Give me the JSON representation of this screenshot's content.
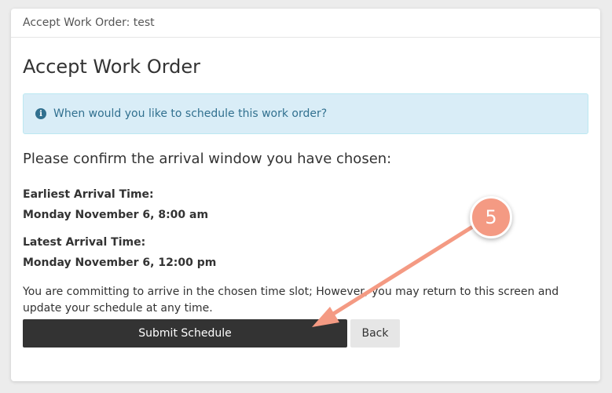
{
  "window": {
    "title": "Accept Work Order: test"
  },
  "page": {
    "title": "Accept Work Order"
  },
  "alert": {
    "icon": "info-icon",
    "text": "When would you like to schedule this work order?",
    "color": "#31708f",
    "background": "#d9edf7"
  },
  "confirm": {
    "heading": "Please confirm the arrival window you have chosen:",
    "earliest_label": "Earliest Arrival Time:",
    "earliest_value": "Monday November 6, 8:00 am",
    "latest_label": "Latest Arrival Time:",
    "latest_value": "Monday November 6, 12:00 pm",
    "commitment": "You are committing to arrive in the chosen time slot; However, you may return to this screen and update your schedule at any time."
  },
  "actions": {
    "submit_label": "Submit Schedule",
    "back_label": "Back"
  },
  "annotation": {
    "step_number": "5",
    "color": "#f49a83"
  }
}
